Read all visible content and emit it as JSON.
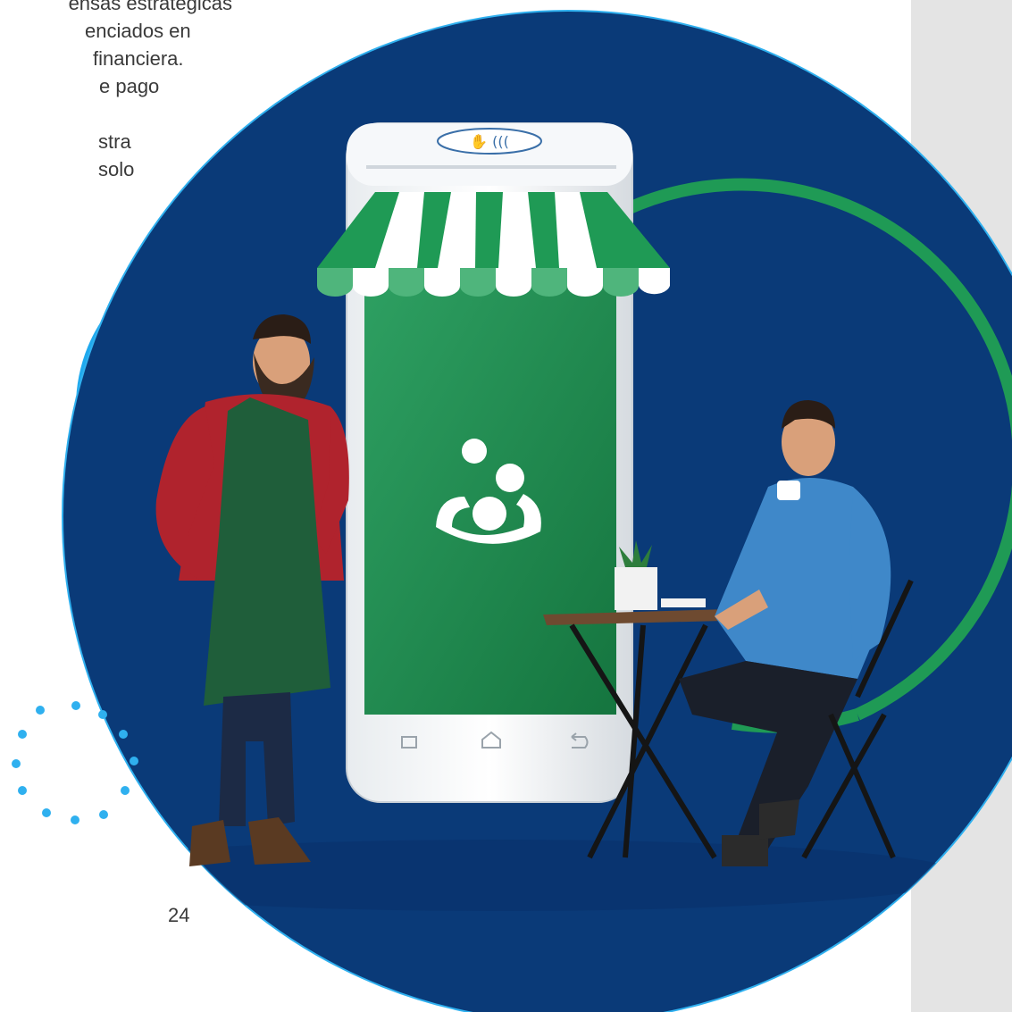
{
  "body_text": {
    "lines": [
      "ensas estratégicas",
      "enciados en",
      "financiera.",
      "e pago",
      "",
      "stra",
      "solo"
    ]
  },
  "page_number": "24",
  "colors": {
    "navy": "#0a3a78",
    "light_blue": "#1fa9ee",
    "green": "#1f9a55",
    "screen_green": "#1d8a4c",
    "side_panel": "#e4e4e4"
  },
  "illustration": {
    "terminal_icon": "contactless-payment-icon",
    "screen_logo": "bank-logo-icon",
    "nav_icons": [
      "recent-apps-icon",
      "home-icon",
      "back-icon"
    ]
  }
}
